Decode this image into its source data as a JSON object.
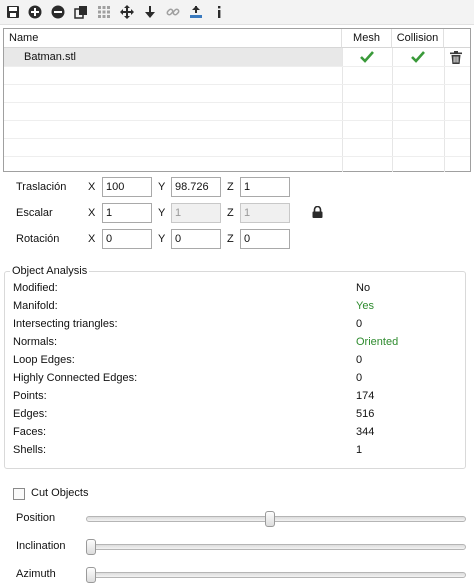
{
  "toolbar": {
    "icons": [
      "save-icon",
      "add-icon",
      "remove-icon",
      "duplicate-icon",
      "grid-icon",
      "move-icon",
      "drop-down-icon",
      "unlink-icon",
      "place-on-bed-icon",
      "info-icon"
    ]
  },
  "table": {
    "headers": {
      "name": "Name",
      "mesh": "Mesh",
      "collision": "Collision"
    },
    "rows": [
      {
        "name": "Batman.stl",
        "mesh": true,
        "collision": true
      }
    ]
  },
  "transform": {
    "translation": {
      "label": "Traslación",
      "x": "100",
      "y": "98.726",
      "z": "1"
    },
    "scale": {
      "label": "Escalar",
      "x": "1",
      "y": "1",
      "z": "1"
    },
    "rotation": {
      "label": "Rotación",
      "x": "0",
      "y": "0",
      "z": "0"
    },
    "axis_labels": {
      "x": "X",
      "y": "Y",
      "z": "Z"
    }
  },
  "analysis": {
    "title": "Object Analysis",
    "items": [
      {
        "label": "Modified:",
        "value": "No"
      },
      {
        "label": "Manifold:",
        "value": "Yes"
      },
      {
        "label": "Intersecting triangles:",
        "value": "0"
      },
      {
        "label": "Normals:",
        "value": "Oriented"
      },
      {
        "label": "Loop Edges:",
        "value": "0"
      },
      {
        "label": "Highly Connected Edges:",
        "value": "0"
      },
      {
        "label": "Points:",
        "value": "174"
      },
      {
        "label": "Edges:",
        "value": "516"
      },
      {
        "label": "Faces:",
        "value": "344"
      },
      {
        "label": "Shells:",
        "value": "1"
      }
    ],
    "good_color": "#2e8b2e"
  },
  "cut": {
    "label": "Cut Objects",
    "checked": false,
    "sliders": [
      {
        "label": "Position",
        "level": 0.49
      },
      {
        "label": "Inclination",
        "level": 0.0
      },
      {
        "label": "Azimuth",
        "level": 0.0
      }
    ]
  },
  "colors": {
    "check": "#3a9a3a"
  }
}
